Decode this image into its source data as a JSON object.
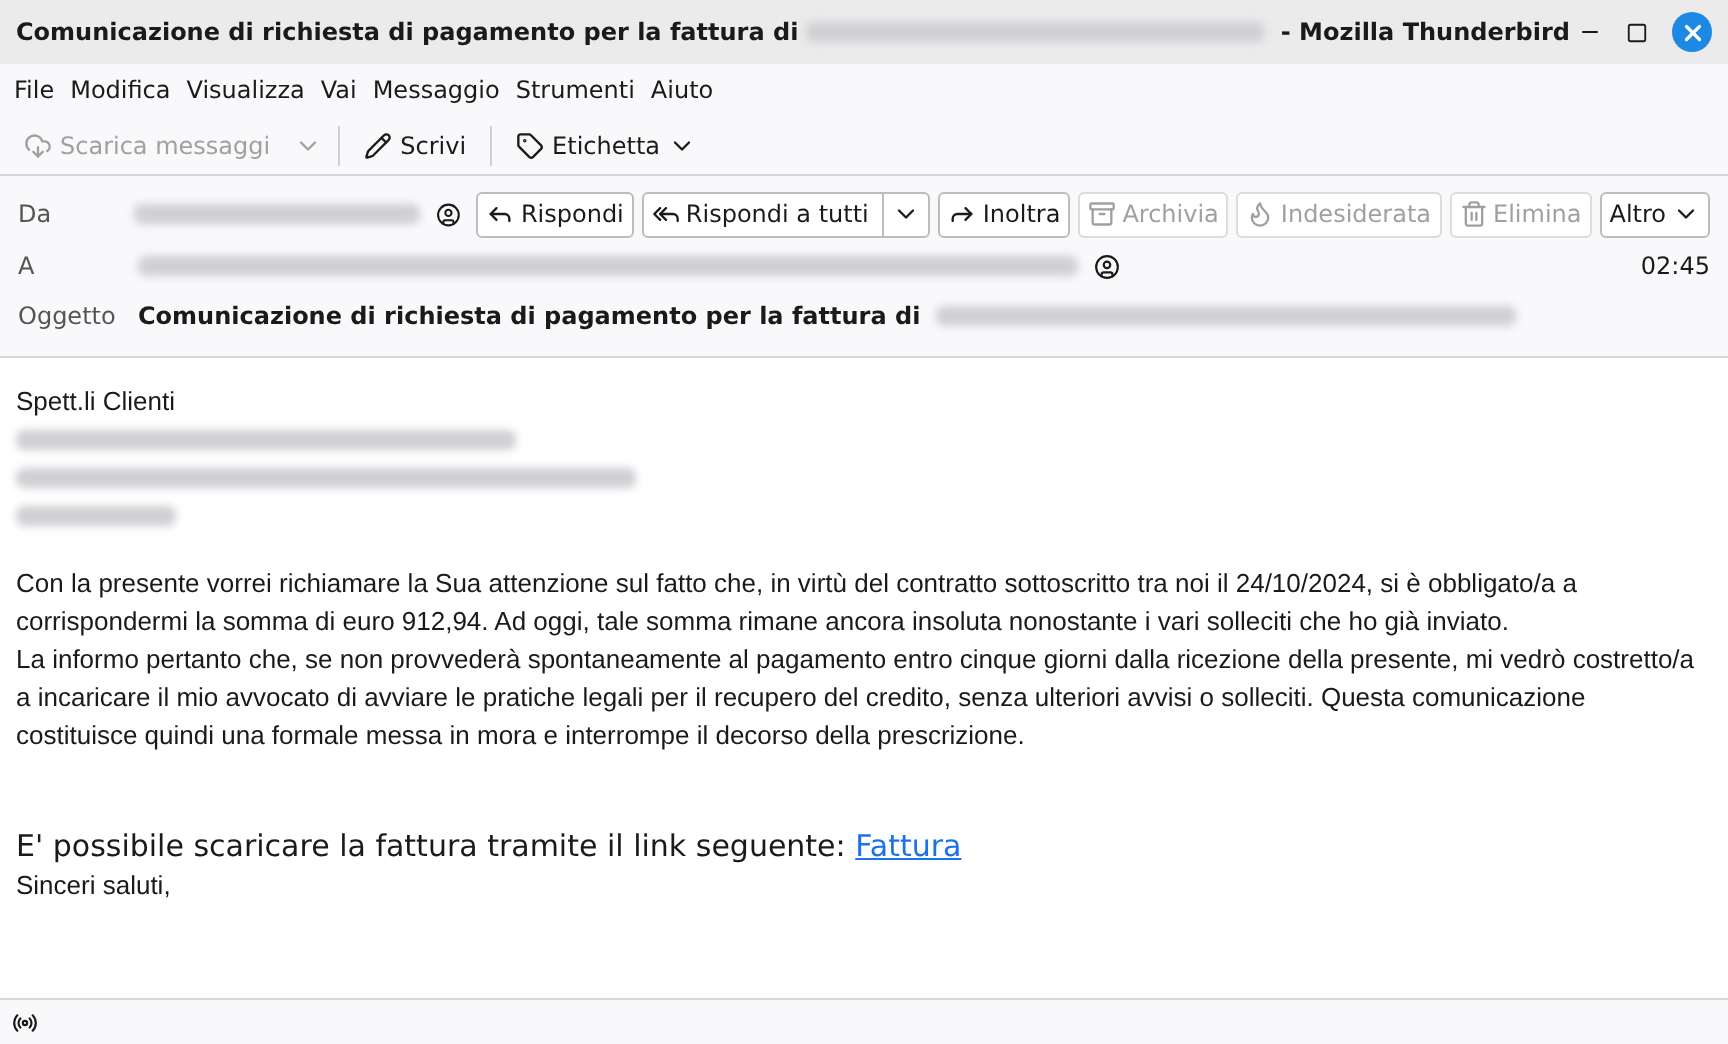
{
  "window": {
    "title_prefix": "Comunicazione di richiesta di pagamento per la fattura di",
    "title_suffix": "- Mozilla Thunderbird"
  },
  "menu": [
    "File",
    "Modifica",
    "Visualizza",
    "Vai",
    "Messaggio",
    "Strumenti",
    "Aiuto"
  ],
  "toolbar": [
    {
      "kind": "get",
      "label": "Scarica messaggi",
      "disabled": true
    },
    {
      "kind": "write",
      "label": "Scrivi",
      "disabled": false
    },
    {
      "kind": "tag",
      "label": "Etichetta",
      "disabled": false
    }
  ],
  "header": {
    "from_label": "Da",
    "to_label": "A",
    "subject_label": "Oggetto",
    "subject": "Comunicazione di richiesta di pagamento per la fattura di",
    "time": "02:45",
    "actions": [
      {
        "kind": "reply",
        "label": "Rispondi",
        "disabled": false
      },
      {
        "kind": "replyall",
        "label": "Rispondi a tutti",
        "disabled": false
      },
      {
        "kind": "forward",
        "label": "Inoltra",
        "disabled": false
      },
      {
        "kind": "archive",
        "label": "Archivia",
        "disabled": true
      },
      {
        "kind": "junk",
        "label": "Indesiderata",
        "disabled": true
      },
      {
        "kind": "delete",
        "label": "Elimina",
        "disabled": true
      },
      {
        "kind": "more",
        "label": "Altro",
        "disabled": false
      }
    ]
  },
  "body": {
    "greeting": "Spett.li Clienti",
    "paragraphs": [
      "Con la presente vorrei richiamare la Sua attenzione sul fatto che, in virtù del contratto sottoscritto tra noi il 24/10/2024, si è obbligato/a a corrispondermi la somma di euro 912,94. Ad oggi, tale somma rimane ancora insoluta nonostante i vari solleciti che ho già inviato.",
      "La informo pertanto che, se non provvederà spontaneamente al pagamento entro cinque giorni dalla ricezione della presente, mi vedrò costretto/a a incaricare il mio avvocato di avviare le pratiche legali per il recupero del credito, senza ulteriori avvisi o solleciti. Questa comunicazione costituisce quindi una formale messa in mora e interrompe il decorso della prescrizione."
    ],
    "link_line": "E' possibile scaricare la fattura tramite il link seguente:",
    "link": "Fattura",
    "closing": "Sinceri saluti,"
  }
}
